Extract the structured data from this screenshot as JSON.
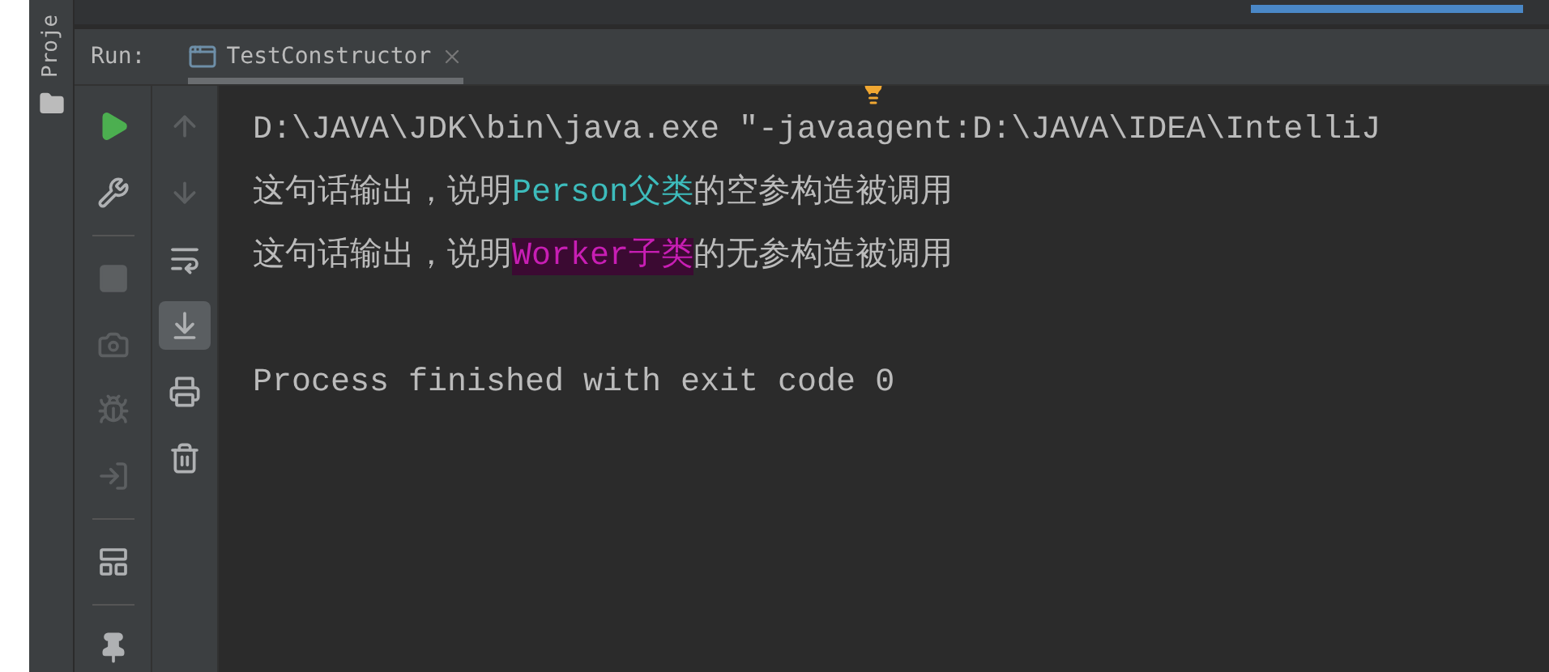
{
  "side_tab": {
    "label": "Proje"
  },
  "run_header": {
    "label": "Run:",
    "tab": {
      "title": "TestConstructor",
      "selected": true
    }
  },
  "left_tools": [
    {
      "kind": "run",
      "disabled": false
    },
    {
      "kind": "wrench",
      "disabled": false
    },
    {
      "kind": "separator"
    },
    {
      "kind": "stop",
      "disabled": true
    },
    {
      "kind": "camera",
      "disabled": true
    },
    {
      "kind": "bug",
      "disabled": true
    },
    {
      "kind": "exit",
      "disabled": true
    },
    {
      "kind": "separator"
    },
    {
      "kind": "layout",
      "disabled": false
    },
    {
      "kind": "separator"
    },
    {
      "kind": "pin",
      "disabled": false
    }
  ],
  "right_tools": [
    {
      "kind": "up",
      "disabled": true,
      "selected": false
    },
    {
      "kind": "down",
      "disabled": true,
      "selected": false
    },
    {
      "kind": "wrap",
      "disabled": false,
      "selected": false
    },
    {
      "kind": "scroll-end",
      "disabled": false,
      "selected": true
    },
    {
      "kind": "print",
      "disabled": false,
      "selected": false
    },
    {
      "kind": "trash",
      "disabled": false,
      "selected": false
    }
  ],
  "console": {
    "lines": [
      {
        "segments": [
          {
            "text": "D:\\JAVA\\JDK\\bin\\java.exe \"-javaagent:D:\\JAVA\\IDEA\\IntelliJ",
            "kind": "plain"
          }
        ]
      },
      {
        "segments": [
          {
            "text": "这句话输出，说明",
            "kind": "plain"
          },
          {
            "text": "Person父类",
            "kind": "accent"
          },
          {
            "text": "的空参构造被调用",
            "kind": "plain"
          }
        ]
      },
      {
        "segments": [
          {
            "text": "这句话输出，说明",
            "kind": "plain"
          },
          {
            "text": "Worker子类",
            "kind": "highlight"
          },
          {
            "text": "的无参构造被调用",
            "kind": "plain"
          }
        ]
      },
      {
        "kind": "blank"
      },
      {
        "segments": [
          {
            "text": "Process finished with exit code 0",
            "kind": "plain"
          }
        ]
      }
    ]
  }
}
